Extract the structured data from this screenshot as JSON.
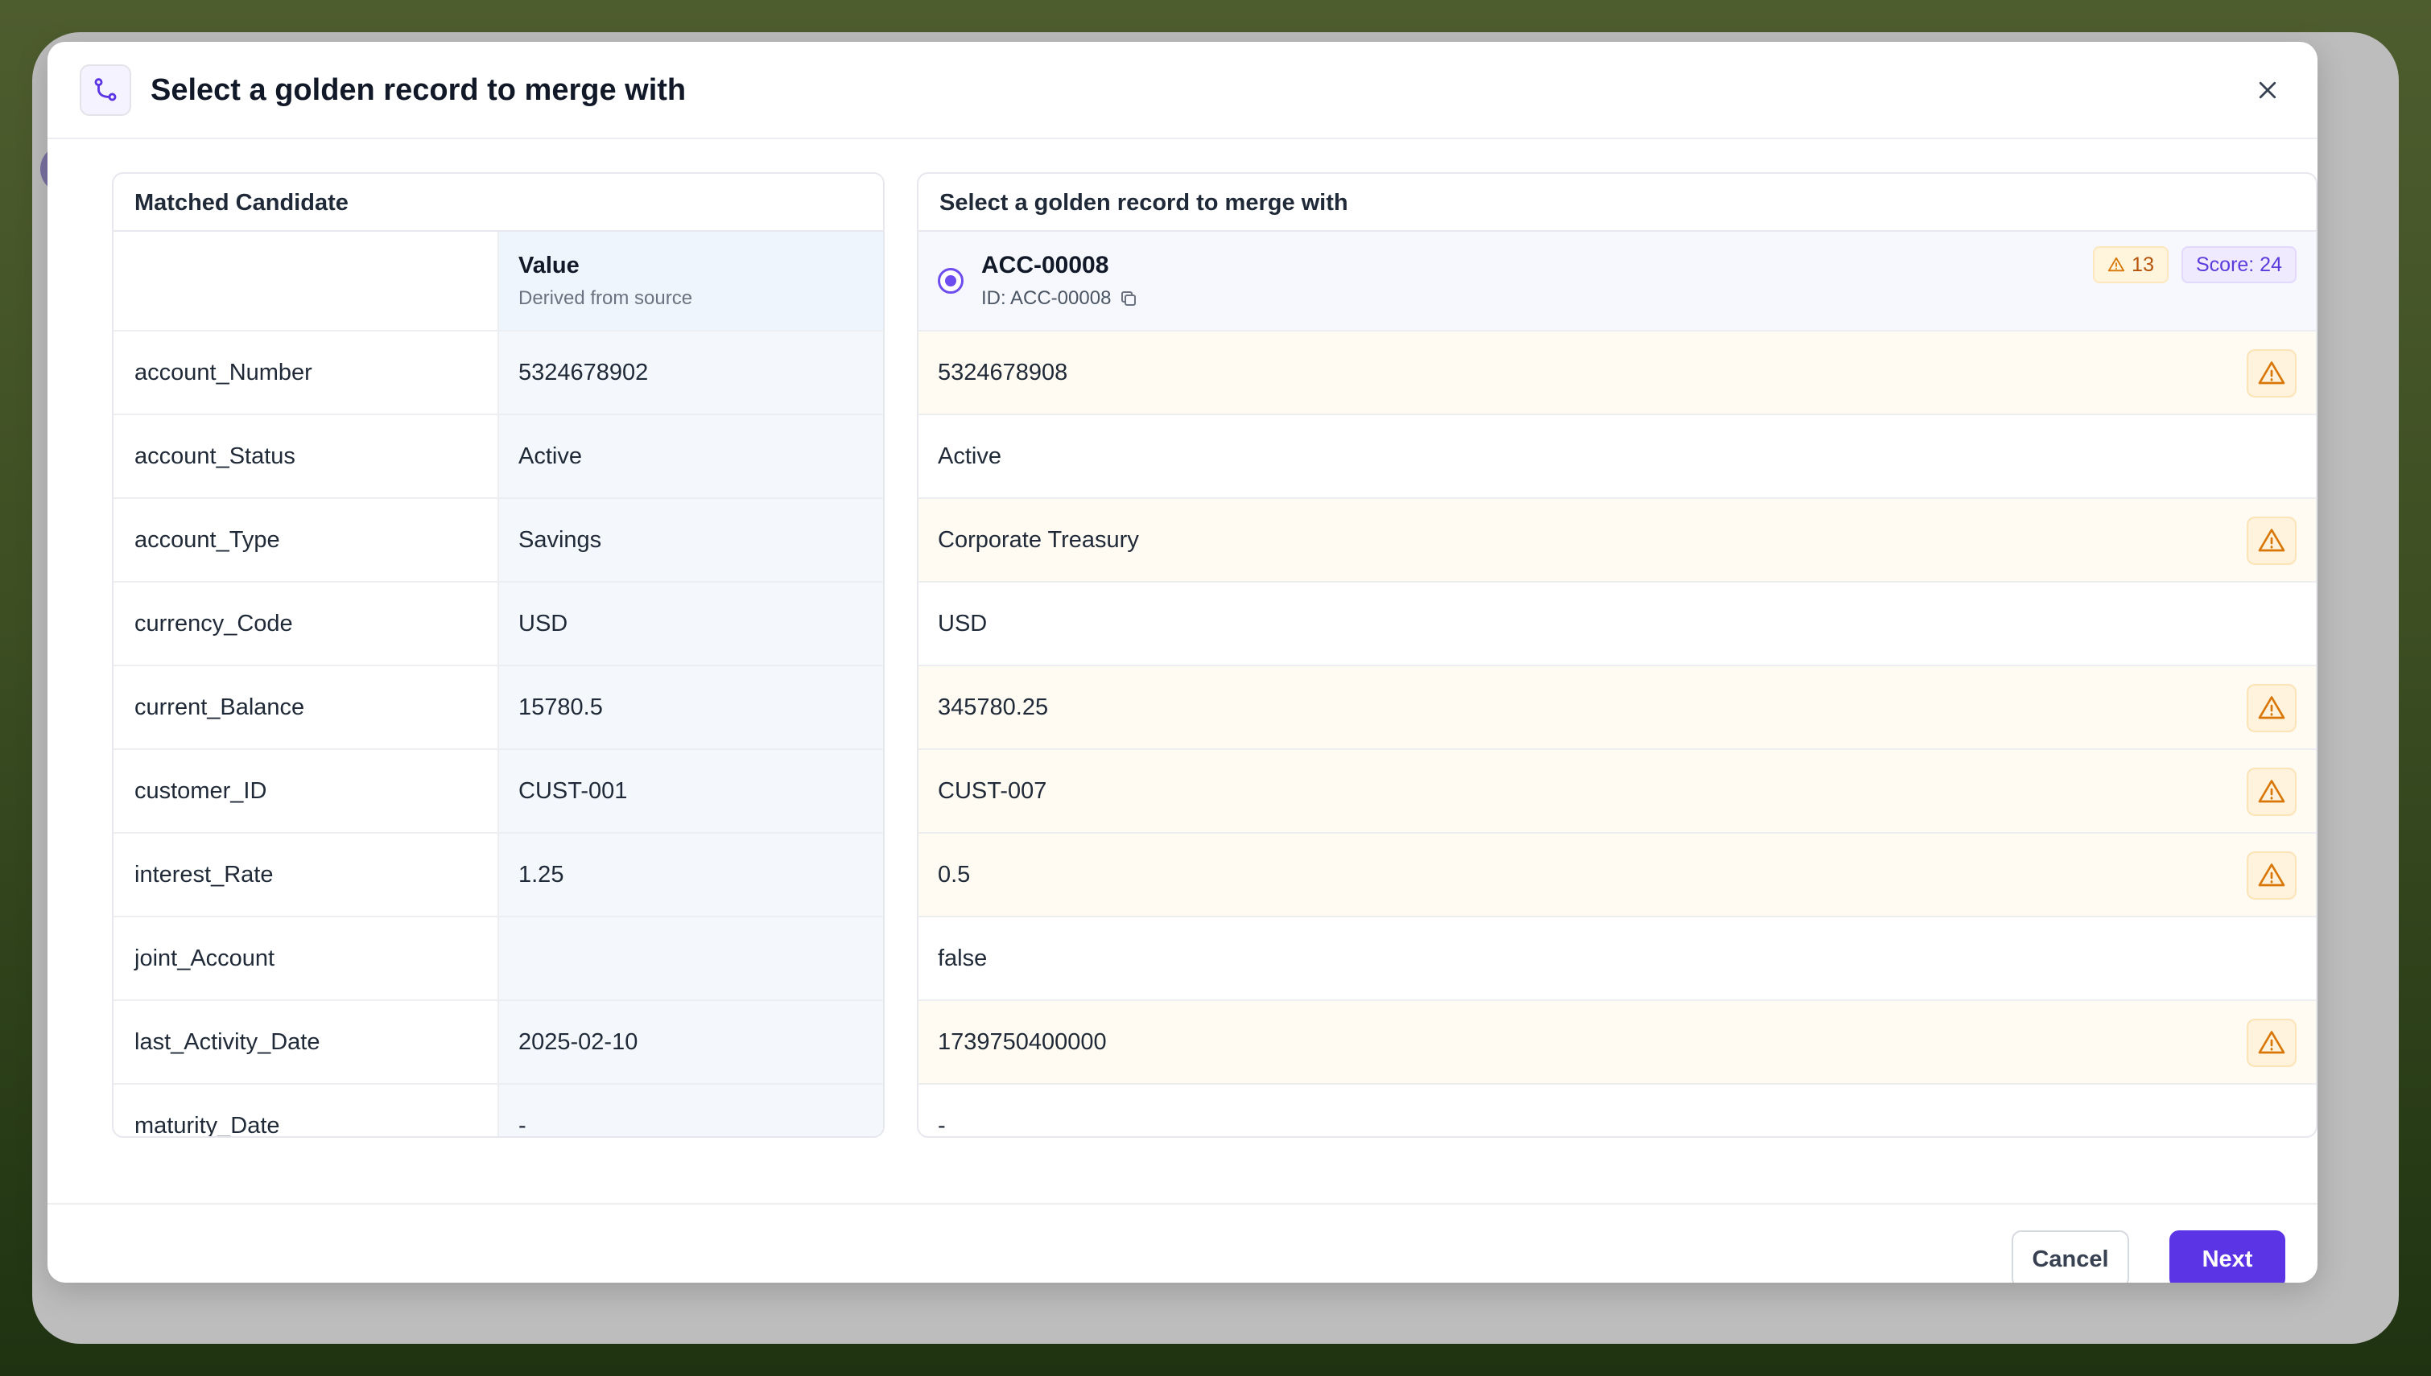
{
  "dialog": {
    "title": "Select a golden record to merge with"
  },
  "left_panel": {
    "title": "Matched Candidate",
    "value_header": "Value",
    "value_subheader": "Derived from source",
    "rows": [
      {
        "field": "account_Number",
        "value": "5324678902"
      },
      {
        "field": "account_Status",
        "value": "Active"
      },
      {
        "field": "account_Type",
        "value": "Savings"
      },
      {
        "field": "currency_Code",
        "value": "USD"
      },
      {
        "field": "current_Balance",
        "value": "15780.5"
      },
      {
        "field": "customer_ID",
        "value": "CUST-001"
      },
      {
        "field": "interest_Rate",
        "value": "1.25"
      },
      {
        "field": "joint_Account",
        "value": ""
      },
      {
        "field": "last_Activity_Date",
        "value": "2025-02-10"
      },
      {
        "field": "maturity_Date",
        "value": "-"
      }
    ]
  },
  "right_panel": {
    "title": "Select a golden record to merge with",
    "record": {
      "name": "ACC-00008",
      "id_label": "ID: ACC-00008",
      "warning_count": "13",
      "score": "Score: 24",
      "selected": true
    },
    "rows": [
      {
        "value": "5324678908",
        "conflict": true
      },
      {
        "value": "Active",
        "conflict": false
      },
      {
        "value": "Corporate Treasury",
        "conflict": true
      },
      {
        "value": "USD",
        "conflict": false
      },
      {
        "value": "345780.25",
        "conflict": true
      },
      {
        "value": "CUST-007",
        "conflict": true
      },
      {
        "value": "0.5",
        "conflict": true
      },
      {
        "value": "false",
        "conflict": false
      },
      {
        "value": "1739750400000",
        "conflict": true
      },
      {
        "value": "-",
        "conflict": false
      }
    ]
  },
  "footer": {
    "cancel_label": "Cancel",
    "next_label": "Next"
  },
  "colors": {
    "accent": "#5b34e6",
    "warning": "#d97706",
    "warning_bg": "#fffbf2"
  },
  "icons": {
    "header": "git-merge-icon",
    "close": "close-icon",
    "copy": "copy-icon",
    "warning": "warning-triangle-icon"
  }
}
